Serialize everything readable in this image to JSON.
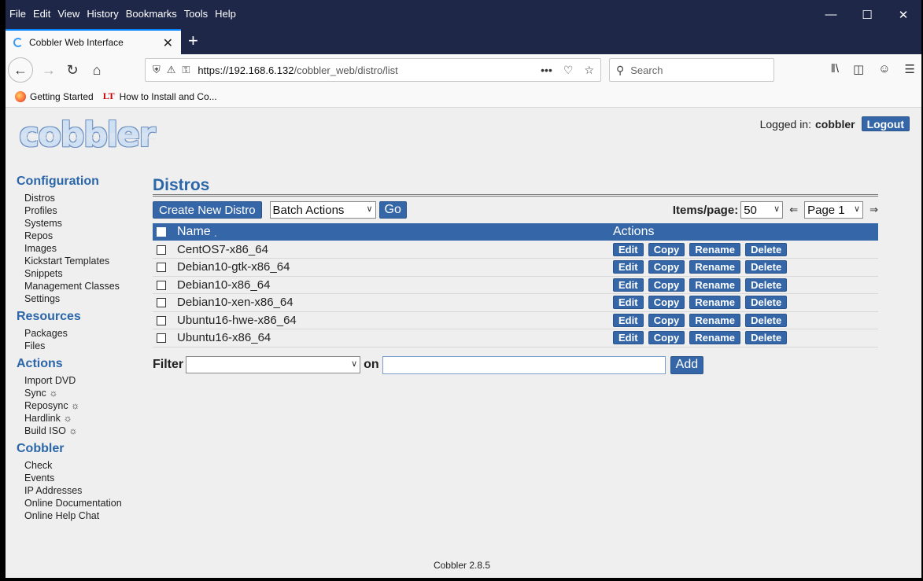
{
  "browser": {
    "menu": [
      "File",
      "Edit",
      "View",
      "History",
      "Bookmarks",
      "Tools",
      "Help"
    ],
    "tab_title": "Cobbler Web Interface",
    "url_host": "https://192.168.6.132",
    "url_path": "/cobbler_web/distro/list",
    "search_placeholder": "Search",
    "bookmarks": [
      "Getting Started",
      "How to Install and Co..."
    ],
    "bookmark_lt": "LT"
  },
  "header": {
    "logo": "cobbler",
    "logged_in_label": "Logged in:",
    "user": "cobbler",
    "logout": "Logout"
  },
  "sidebar": {
    "configuration": {
      "title": "Configuration",
      "items": [
        "Distros",
        "Profiles",
        "Systems",
        "Repos",
        "Images",
        "Kickstart Templates",
        "Snippets",
        "Management Classes",
        "Settings"
      ]
    },
    "resources": {
      "title": "Resources",
      "items": [
        "Packages",
        "Files"
      ]
    },
    "actions": {
      "title": "Actions",
      "items": [
        "Import DVD",
        "Sync ☼",
        "Reposync ☼",
        "Hardlink ☼",
        "Build ISO ☼"
      ]
    },
    "cobbler": {
      "title": "Cobbler",
      "items": [
        "Check",
        "Events",
        "IP Addresses",
        "Online Documentation",
        "Online Help Chat"
      ]
    }
  },
  "main": {
    "title": "Distros",
    "create_button": "Create New Distro",
    "batch_actions": "Batch Actions",
    "go": "Go",
    "items_per_page_label": "Items/page:",
    "items_per_page": "50",
    "prev_arrow": "⇐",
    "page": "Page 1",
    "next_arrow": "⇒",
    "col_name": "Name",
    "col_sort": "˯",
    "col_actions": "Actions",
    "rows": [
      "CentOS7-x86_64",
      "Debian10-gtk-x86_64",
      "Debian10-x86_64",
      "Debian10-xen-x86_64",
      "Ubuntu16-hwe-x86_64",
      "Ubuntu16-x86_64"
    ],
    "actions": {
      "edit": "Edit",
      "copy": "Copy",
      "rename": "Rename",
      "delete": "Delete"
    },
    "filter_label": "Filter",
    "on_label": "on",
    "add": "Add"
  },
  "footer": "Cobbler 2.8.5"
}
